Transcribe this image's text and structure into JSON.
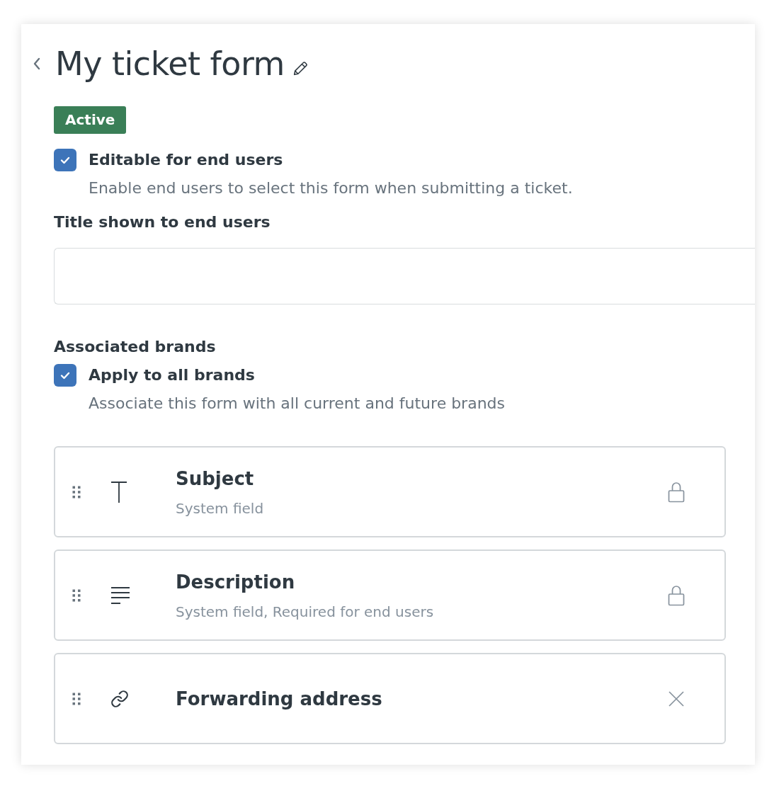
{
  "page": {
    "title": "My ticket form",
    "status": {
      "label": "Active",
      "kind": "active"
    }
  },
  "editable_option": {
    "label": "Editable for end users",
    "hint": "Enable end users to select this form when submitting a ticket.",
    "checked": true
  },
  "title_field": {
    "label": "Title shown to end users"
  },
  "brands": {
    "heading": "Associated brands",
    "option": {
      "label": "Apply to all brands",
      "hint": "Associate this form with all current and future brands",
      "checked": true
    }
  },
  "fields": [
    {
      "kind": "text",
      "name": "Subject",
      "subtitle": "System field",
      "locked": true
    },
    {
      "kind": "multiline",
      "name": "Description",
      "subtitle": "System field, Required for end users",
      "locked": true
    },
    {
      "kind": "link",
      "name": "Forwarding address",
      "locked": false
    }
  ]
}
